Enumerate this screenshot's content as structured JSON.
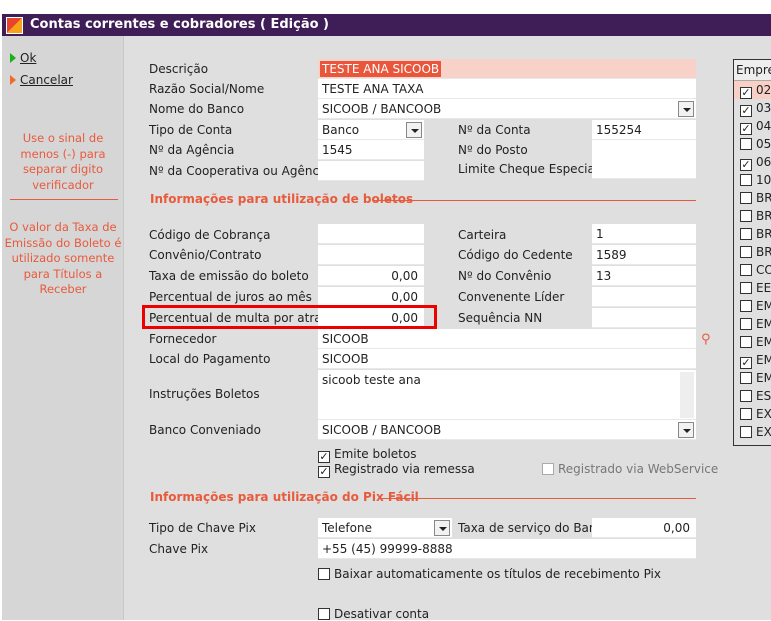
{
  "window": {
    "title": "Contas correntes e cobradores ( Edição )"
  },
  "actions": {
    "ok": "Ok",
    "cancel": "Cancelar"
  },
  "notes": {
    "minus": "Use o sinal de menos (-) para separar digito verificador",
    "taxa": "O valor da Taxa de Emissão do Boleto é utilizado somente para Títulos a Receber"
  },
  "form": {
    "descricao": {
      "label": "Descrição",
      "value": "TESTE ANA SICOOB"
    },
    "razao": {
      "label": "Razão Social/Nome",
      "value": "TESTE ANA TAXA"
    },
    "banco": {
      "label": "Nome do Banco",
      "value": "SICOOB / BANCOOB"
    },
    "tipo_conta": {
      "label": "Tipo de Conta",
      "value": "Banco"
    },
    "num_conta": {
      "label": "Nº da Conta",
      "value": "155254"
    },
    "agencia": {
      "label": "Nº da Agência",
      "value": "1545"
    },
    "posto": {
      "label": "Nº do Posto",
      "value": ""
    },
    "cooperativa": {
      "label": "Nº da Cooperativa ou Agência",
      "value": ""
    },
    "limite": {
      "label": "Limite Cheque Especial",
      "value": ""
    }
  },
  "boletos": {
    "section": "Informações para utilização de boletos",
    "cod_cobranca": {
      "label": "Código de Cobrança",
      "value": ""
    },
    "carteira": {
      "label": "Carteira",
      "value": "1"
    },
    "convenio_contrato": {
      "label": "Convênio/Contrato",
      "value": ""
    },
    "cedente": {
      "label": "Código do Cedente",
      "value": "1589"
    },
    "taxa": {
      "label": "Taxa de emissão do boleto",
      "value": "0,00"
    },
    "num_convenio": {
      "label": "Nº do Convênio",
      "value": "13"
    },
    "juros": {
      "label": "Percentual de juros ao mês",
      "value": "0,00"
    },
    "lider": {
      "label": "Convenente Líder",
      "value": ""
    },
    "multa": {
      "label": "Percentual de multa por atraso",
      "value": "0,00"
    },
    "seq": {
      "label": "Sequência NN",
      "value": ""
    },
    "fornecedor": {
      "label": "Fornecedor",
      "value": "SICOOB"
    },
    "local": {
      "label": "Local do Pagamento",
      "value": "SICOOB"
    },
    "instrucoes": {
      "label": "Instruções Boletos",
      "value": "sicoob teste ana"
    },
    "conveniado": {
      "label": "Banco Conveniado",
      "value": "SICOOB / BANCOOB"
    },
    "emite": {
      "label": "Emite boletos",
      "checked": true
    },
    "remessa": {
      "label": "Registrado via remessa",
      "checked": true
    },
    "webservice": {
      "label": "Registrado via WebService",
      "checked": false
    }
  },
  "pix": {
    "section": "Informações para utilização do Pix Fácil",
    "tipo": {
      "label": "Tipo de Chave Pix",
      "value": "Telefone"
    },
    "taxa": {
      "label": "Taxa de serviço do Banco",
      "value": "0,00"
    },
    "chave": {
      "label": "Chave Pix",
      "value": "+55 (45) 99999-8888"
    },
    "baixar": {
      "label": "Baixar automaticamente os títulos de recebimento Pix",
      "checked": false
    },
    "desativar": {
      "label": "Desativar conta",
      "checked": false
    }
  },
  "empresas": {
    "header": "Empres",
    "items": [
      {
        "label": "02-",
        "checked": true
      },
      {
        "label": "03-",
        "checked": true
      },
      {
        "label": "04-",
        "checked": true
      },
      {
        "label": "05-",
        "checked": false
      },
      {
        "label": "06-",
        "checked": true
      },
      {
        "label": "10-",
        "checked": false
      },
      {
        "label": "BR",
        "checked": false
      },
      {
        "label": "BR",
        "checked": false
      },
      {
        "label": "BR",
        "checked": false
      },
      {
        "label": "BR",
        "checked": false
      },
      {
        "label": "CO",
        "checked": false
      },
      {
        "label": "EEI",
        "checked": false
      },
      {
        "label": "EM",
        "checked": false
      },
      {
        "label": "EM",
        "checked": false
      },
      {
        "label": "EM",
        "checked": false
      },
      {
        "label": "EM",
        "checked": true
      },
      {
        "label": "EM",
        "checked": false
      },
      {
        "label": "ESP",
        "checked": false
      },
      {
        "label": "EXT",
        "checked": false
      },
      {
        "label": "EXT",
        "checked": false
      }
    ]
  },
  "colors": {
    "title_bar": "#3f1d56",
    "accent": "#e85a3c",
    "highlight_box": "#ee0000"
  }
}
